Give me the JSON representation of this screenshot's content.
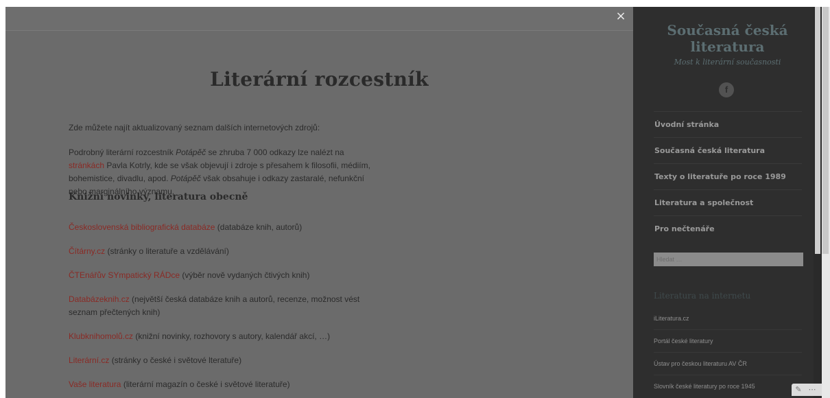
{
  "modal": {
    "close_label": "×"
  },
  "page": {
    "title": "Literární rozcestník",
    "intro": "Zde můžete najít aktualizovaný seznam dalších internetových zdrojů:",
    "para": {
      "t1": "Podrobný literární rozcestník ",
      "em1": "Potápěč",
      "t2": " se zhruba 7 000 odkazy lze nalézt na ",
      "link": "stránkách",
      "t3": " Pavla Kotrly, kde se však objevují i zdroje s přesahem k filosofii, médiím, bohemistice, divadlu, apod. ",
      "em2": "Potápěč",
      "t4": " však obsahuje i odkazy zastaralé, nefunkční nebo marginálního významu."
    },
    "section_title": "Knižní novinky, literatura obecně",
    "links": [
      {
        "name": "Československá bibliografická databáze",
        "desc": " (databáze knih, autorů)"
      },
      {
        "name": "Čítárny.cz",
        "desc": " (stránky o literatuře a vzdělávání)"
      },
      {
        "name": "ČTEnářův SYmpatický RÁDce",
        "desc": " (výběr nově vydaných čtivých knih)"
      },
      {
        "name": "Databázeknih.cz",
        "desc": " (největší česká databáze knih a autorů, recenze, možnost vést seznam přečtených knih)"
      },
      {
        "name": "Klubknihomolů.cz",
        "desc": " (knižní novinky, rozhovory s autory, kalendář akcí, …)"
      },
      {
        "name": "Literární.cz",
        "desc": " (stránky o české i světové lteratuře)"
      },
      {
        "name": "Vaše literatura",
        "desc": " (literární magazín o české i světové literatuře)"
      }
    ]
  },
  "sidebar": {
    "site_title": "Současná česká literatura",
    "tagline": "Most k literární současnosti",
    "fb_icon": "f",
    "nav": [
      "Úvodní stránka",
      "Současná česká literatura",
      "Texty o literatuře po roce 1989",
      "Literatura a společnost",
      "Pro nečtenáře"
    ],
    "search_placeholder": "Hledat …",
    "widget_title": "Literatura na internetu",
    "widget_links": [
      "iLiteratura.cz",
      "Portál české literatury",
      "Ústav pro českou literaturu AV ČR",
      "Slovník české literatury po roce 1945"
    ]
  },
  "tools": {
    "edit_icon": "✎",
    "more_icon": "⋯"
  },
  "colors": {
    "overlay": "#6b6b6b",
    "sidebar": "#2e2e2e",
    "link": "#8a2a25"
  }
}
